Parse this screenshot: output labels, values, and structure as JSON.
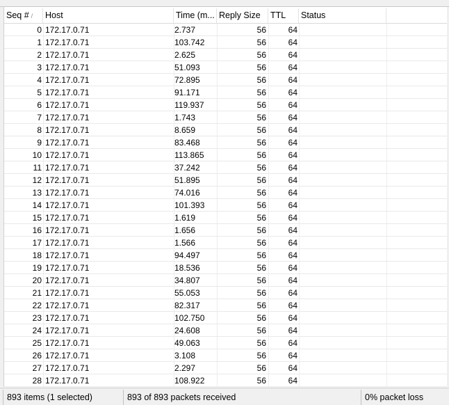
{
  "columns": {
    "seq": "Seq #",
    "seq_sort_icon": "/",
    "host": "Host",
    "time": "Time (m...",
    "reply_size": "Reply Size",
    "ttl": "TTL",
    "status": "Status"
  },
  "rows": [
    {
      "seq": "0",
      "host": "172.17.0.71",
      "time": "2.737",
      "size": "56",
      "ttl": "64",
      "status": ""
    },
    {
      "seq": "1",
      "host": "172.17.0.71",
      "time": "103.742",
      "size": "56",
      "ttl": "64",
      "status": ""
    },
    {
      "seq": "2",
      "host": "172.17.0.71",
      "time": "2.625",
      "size": "56",
      "ttl": "64",
      "status": ""
    },
    {
      "seq": "3",
      "host": "172.17.0.71",
      "time": "51.093",
      "size": "56",
      "ttl": "64",
      "status": ""
    },
    {
      "seq": "4",
      "host": "172.17.0.71",
      "time": "72.895",
      "size": "56",
      "ttl": "64",
      "status": ""
    },
    {
      "seq": "5",
      "host": "172.17.0.71",
      "time": "91.171",
      "size": "56",
      "ttl": "64",
      "status": ""
    },
    {
      "seq": "6",
      "host": "172.17.0.71",
      "time": "119.937",
      "size": "56",
      "ttl": "64",
      "status": ""
    },
    {
      "seq": "7",
      "host": "172.17.0.71",
      "time": "1.743",
      "size": "56",
      "ttl": "64",
      "status": ""
    },
    {
      "seq": "8",
      "host": "172.17.0.71",
      "time": "8.659",
      "size": "56",
      "ttl": "64",
      "status": ""
    },
    {
      "seq": "9",
      "host": "172.17.0.71",
      "time": "83.468",
      "size": "56",
      "ttl": "64",
      "status": ""
    },
    {
      "seq": "10",
      "host": "172.17.0.71",
      "time": "113.865",
      "size": "56",
      "ttl": "64",
      "status": ""
    },
    {
      "seq": "11",
      "host": "172.17.0.71",
      "time": "37.242",
      "size": "56",
      "ttl": "64",
      "status": ""
    },
    {
      "seq": "12",
      "host": "172.17.0.71",
      "time": "51.895",
      "size": "56",
      "ttl": "64",
      "status": ""
    },
    {
      "seq": "13",
      "host": "172.17.0.71",
      "time": "74.016",
      "size": "56",
      "ttl": "64",
      "status": ""
    },
    {
      "seq": "14",
      "host": "172.17.0.71",
      "time": "101.393",
      "size": "56",
      "ttl": "64",
      "status": ""
    },
    {
      "seq": "15",
      "host": "172.17.0.71",
      "time": "1.619",
      "size": "56",
      "ttl": "64",
      "status": ""
    },
    {
      "seq": "16",
      "host": "172.17.0.71",
      "time": "1.656",
      "size": "56",
      "ttl": "64",
      "status": ""
    },
    {
      "seq": "17",
      "host": "172.17.0.71",
      "time": "1.566",
      "size": "56",
      "ttl": "64",
      "status": ""
    },
    {
      "seq": "18",
      "host": "172.17.0.71",
      "time": "94.497",
      "size": "56",
      "ttl": "64",
      "status": ""
    },
    {
      "seq": "19",
      "host": "172.17.0.71",
      "time": "18.536",
      "size": "56",
      "ttl": "64",
      "status": ""
    },
    {
      "seq": "20",
      "host": "172.17.0.71",
      "time": "34.807",
      "size": "56",
      "ttl": "64",
      "status": ""
    },
    {
      "seq": "21",
      "host": "172.17.0.71",
      "time": "55.053",
      "size": "56",
      "ttl": "64",
      "status": ""
    },
    {
      "seq": "22",
      "host": "172.17.0.71",
      "time": "82.317",
      "size": "56",
      "ttl": "64",
      "status": ""
    },
    {
      "seq": "23",
      "host": "172.17.0.71",
      "time": "102.750",
      "size": "56",
      "ttl": "64",
      "status": ""
    },
    {
      "seq": "24",
      "host": "172.17.0.71",
      "time": "24.608",
      "size": "56",
      "ttl": "64",
      "status": ""
    },
    {
      "seq": "25",
      "host": "172.17.0.71",
      "time": "49.063",
      "size": "56",
      "ttl": "64",
      "status": ""
    },
    {
      "seq": "26",
      "host": "172.17.0.71",
      "time": "3.108",
      "size": "56",
      "ttl": "64",
      "status": ""
    },
    {
      "seq": "27",
      "host": "172.17.0.71",
      "time": "2.297",
      "size": "56",
      "ttl": "64",
      "status": ""
    },
    {
      "seq": "28",
      "host": "172.17.0.71",
      "time": "108.922",
      "size": "56",
      "ttl": "64",
      "status": ""
    }
  ],
  "statusbar": {
    "items": "893 items (1 selected)",
    "received": "893 of 893 packets received",
    "loss": "0% packet loss"
  }
}
